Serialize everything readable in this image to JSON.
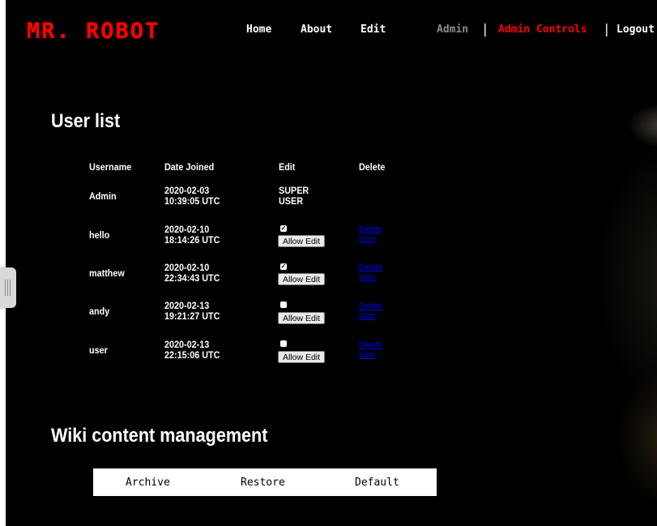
{
  "nav": {
    "logo": "MR. ROBOT",
    "home": "Home",
    "about": "About",
    "edit": "Edit",
    "admin": "Admin",
    "separator": "|",
    "admin_controls": "Admin Controls",
    "logout": "Logout"
  },
  "colors": {
    "accent": "#ff0000",
    "background": "#000000",
    "muted": "#8c8c8c",
    "link": "#0000ee"
  },
  "user_list": {
    "title": "User list",
    "columns": [
      "Username",
      "Date Joined",
      "Edit",
      "Delete"
    ],
    "rows": [
      {
        "username": "Admin",
        "date": "2020-02-03",
        "time": "10:39:05 UTC",
        "edit_text": "SUPER USER"
      },
      {
        "username": "hello",
        "date": "2020-02-10",
        "time": "18:14:26 UTC",
        "checked": true,
        "button": "Allow Edit",
        "delete": "Delete User"
      },
      {
        "username": "matthew",
        "date": "2020-02-10",
        "time": "22:34:43 UTC",
        "checked": true,
        "button": "Allow Edit",
        "delete": "Delete User"
      },
      {
        "username": "andy",
        "date": "2020-02-13",
        "time": "19:21:27 UTC",
        "checked": false,
        "button": "Allow Edit",
        "delete": "Delete User"
      },
      {
        "username": "user",
        "date": "2020-02-13",
        "time": "22:15:06 UTC",
        "checked": false,
        "button": "Allow Edit",
        "delete": "Delete User"
      }
    ]
  },
  "wiki": {
    "title": "Wiki content management",
    "archive": "Archive",
    "restore": "Restore",
    "default": "Default"
  }
}
